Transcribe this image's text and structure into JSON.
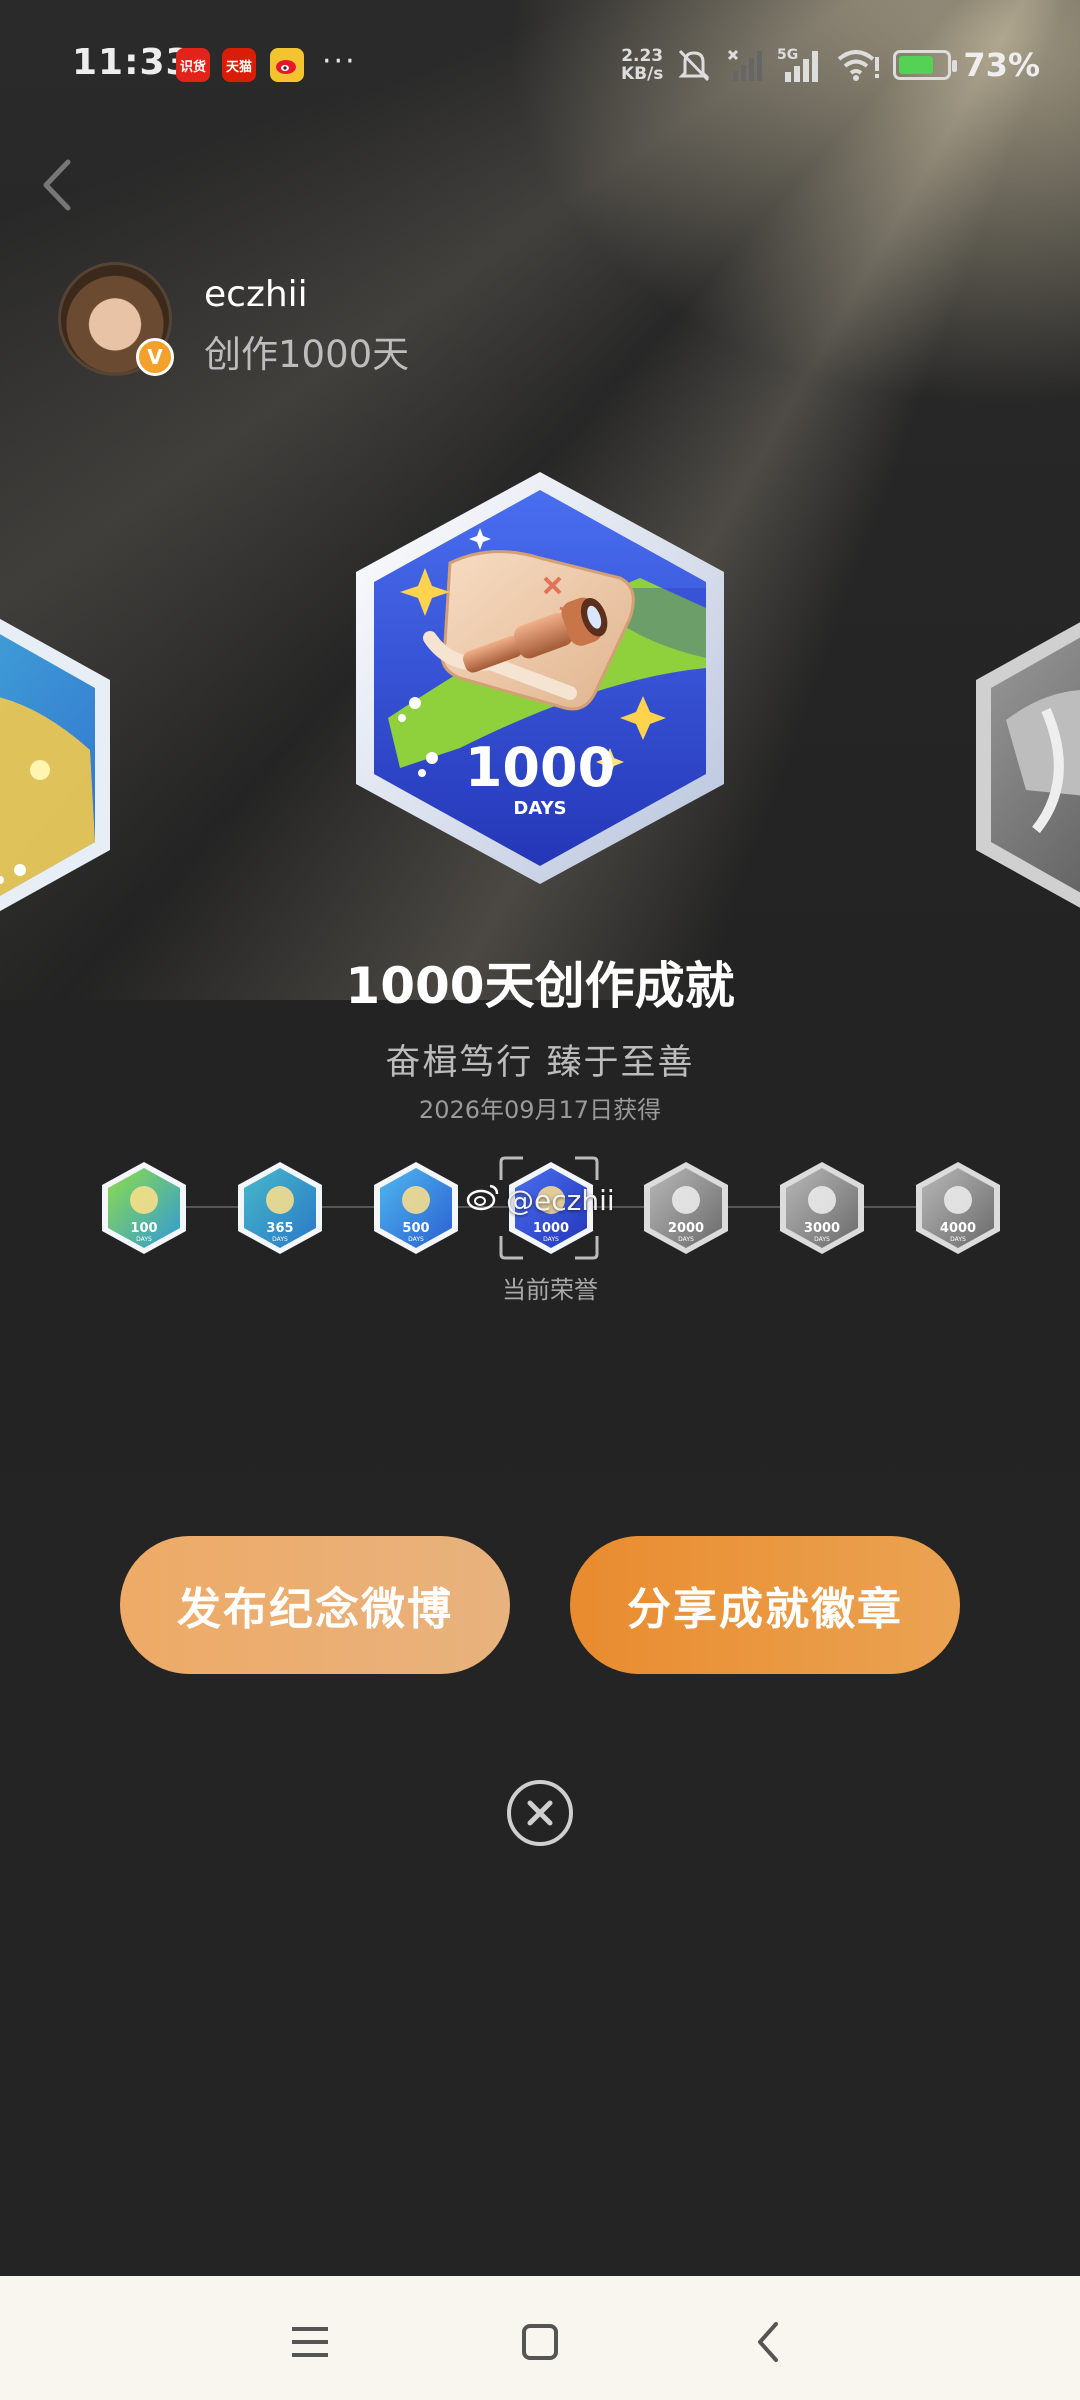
{
  "status_bar": {
    "time": "11:33",
    "apps": [
      "识货",
      "天猫",
      "weibo"
    ],
    "more": "···",
    "net_speed_value": "2.23",
    "net_speed_unit": "KB/s",
    "network": "5G",
    "battery_percent": "73%",
    "battery_level": 0.73
  },
  "profile": {
    "username": "eczhii",
    "subtitle": "创作1000天"
  },
  "achievement": {
    "badge_days": "1000",
    "badge_unit": "DAYS",
    "title": "1000天创作成就",
    "slogan": "奋楫笃行 臻于至善",
    "date": "2026年09月17日获得"
  },
  "timeline": {
    "milestones": [
      {
        "days": "100",
        "unit": "DAYS",
        "earned": true
      },
      {
        "days": "365",
        "unit": "DAYS",
        "earned": true
      },
      {
        "days": "500",
        "unit": "DAYS",
        "earned": true
      },
      {
        "days": "1000",
        "unit": "DAYS",
        "earned": true,
        "current": true
      },
      {
        "days": "2000",
        "unit": "DAYS",
        "earned": false
      },
      {
        "days": "3000",
        "unit": "DAYS",
        "earned": false
      },
      {
        "days": "4000",
        "unit": "DAYS",
        "earned": false
      }
    ],
    "current_label": "当前荣誉",
    "watermark": "@eczhii"
  },
  "actions": {
    "post_label": "发布纪念微博",
    "share_label": "分享成就徽章"
  },
  "colors": {
    "accent_light": "#eeaa66",
    "accent": "#e98b2e",
    "badge_blue": "#2f47c8",
    "badge_green": "#7cc13a"
  }
}
